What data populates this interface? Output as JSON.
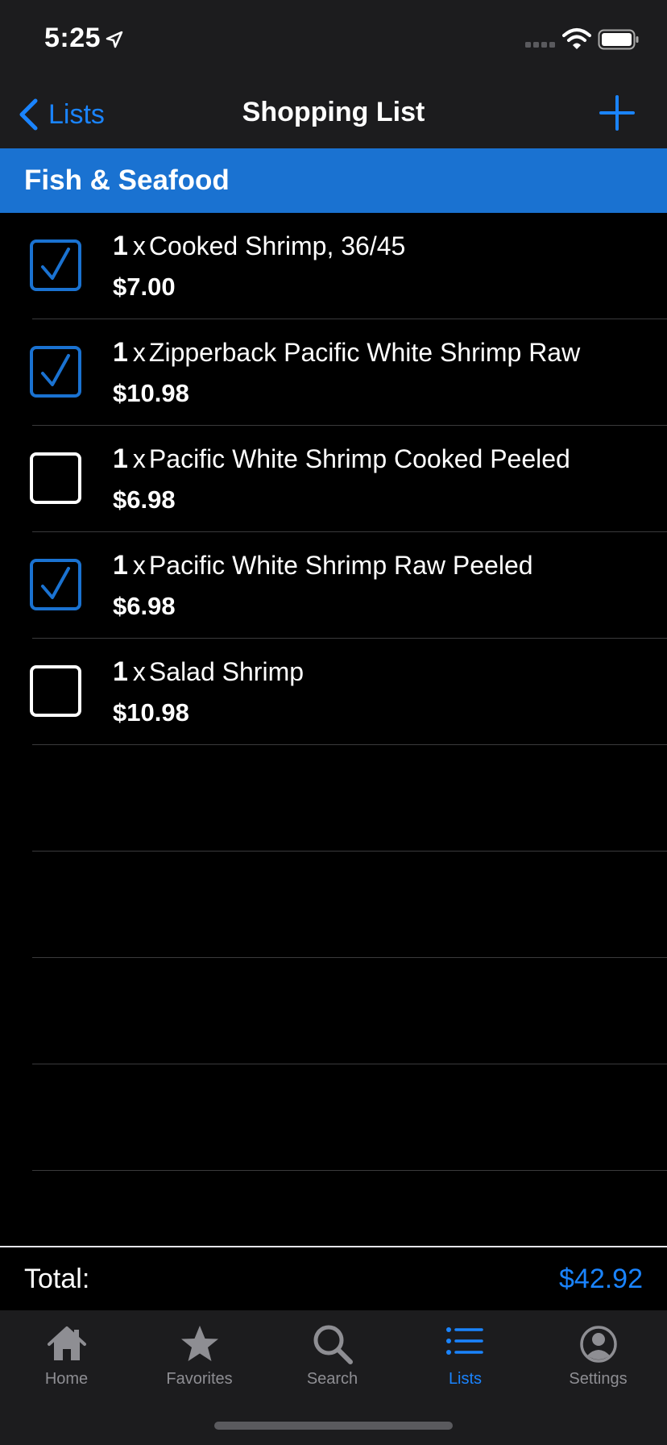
{
  "status_bar": {
    "time": "5:25"
  },
  "nav": {
    "back_label": "Lists",
    "title": "Shopping List"
  },
  "section": {
    "title": "Fish & Seafood"
  },
  "items": [
    {
      "qty": "1",
      "times": "x",
      "name": "Cooked Shrimp, 36/45",
      "price": "$7.00",
      "checked": true
    },
    {
      "qty": "1",
      "times": "x",
      "name": "Zipperback Pacific White Shrimp Raw",
      "price": "$10.98",
      "checked": true
    },
    {
      "qty": "1",
      "times": "x",
      "name": "Pacific White Shrimp Cooked Peeled",
      "price": "$6.98",
      "checked": false
    },
    {
      "qty": "1",
      "times": "x",
      "name": "Pacific White Shrimp Raw Peeled",
      "price": "$6.98",
      "checked": true
    },
    {
      "qty": "1",
      "times": "x",
      "name": "Salad Shrimp",
      "price": "$10.98",
      "checked": false
    }
  ],
  "total": {
    "label": "Total:",
    "value": "$42.92"
  },
  "tabs": [
    {
      "label": "Home",
      "icon": "home-icon",
      "active": false
    },
    {
      "label": "Favorites",
      "icon": "star-icon",
      "active": false
    },
    {
      "label": "Search",
      "icon": "search-icon",
      "active": false
    },
    {
      "label": "Lists",
      "icon": "list-icon",
      "active": true
    },
    {
      "label": "Settings",
      "icon": "person-icon",
      "active": false
    }
  ],
  "colors": {
    "accent": "#1a84ff",
    "section_header": "#1a72d1",
    "background": "#000000",
    "bar": "#1c1c1e"
  }
}
